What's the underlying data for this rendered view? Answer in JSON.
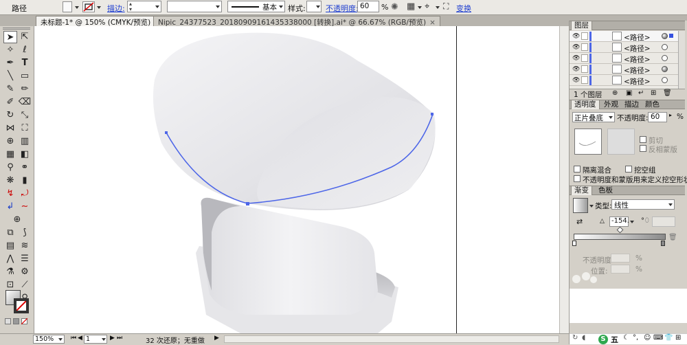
{
  "control_bar": {
    "object_type": "路径",
    "stroke_label": "描边:",
    "stroke_weight_value": "",
    "brush_profile": "基本",
    "style_label": "样式:",
    "opacity_label": "不透明度:",
    "opacity_value": "60",
    "opacity_unit": "%",
    "transform_label": "变换"
  },
  "tabs": [
    {
      "label": "未标题-1* @ 150% (CMYK/预览)",
      "close": "×"
    },
    {
      "label": "Nipic_24377523_20180909161435338000 [转换].ai* @ 66.67% (RGB/预览)",
      "close": "×"
    }
  ],
  "status_bar": {
    "zoom": "150%",
    "page": "1",
    "status_text": "32 次还原；无重做"
  },
  "layers_panel": {
    "title": "图层",
    "rows": [
      {
        "name": "<路径>",
        "target": "filled"
      },
      {
        "name": "<路径>",
        "target": "empty"
      },
      {
        "name": "<路径>",
        "target": "empty"
      },
      {
        "name": "<路径>",
        "target": "filled"
      },
      {
        "name": "<路径>",
        "target": "empty"
      }
    ],
    "footer_count": "1 个图层"
  },
  "transparency_panel": {
    "tabs": [
      "透明度",
      "外观",
      "描边",
      "颜色"
    ],
    "blend_mode": "正片叠底",
    "opacity_label": "不透明度:",
    "opacity_value": "60",
    "opacity_unit": "%",
    "clip_label": "剪切",
    "invert_mask_label": "反相蒙版",
    "isolate_blend_label": "隔离混合",
    "knockout_group_label": "挖空组",
    "opacity_mask_label": "不透明度和蒙版用来定义挖空形状"
  },
  "gradient_panel": {
    "tabs": [
      "渐变",
      "色板"
    ],
    "type_label": "类型:",
    "type_value": "线性",
    "angle_value": "-154.",
    "angle_unit": "°",
    "stop_opacity_label": "不透明度:",
    "stop_location_label": "位置:",
    "percent": "%"
  },
  "taskbar": {
    "ime": "五"
  },
  "colors": {
    "path_selection": "#4d66e8",
    "layer_stripe": "#4d66e8",
    "link_blue": "#1f3fd0"
  }
}
